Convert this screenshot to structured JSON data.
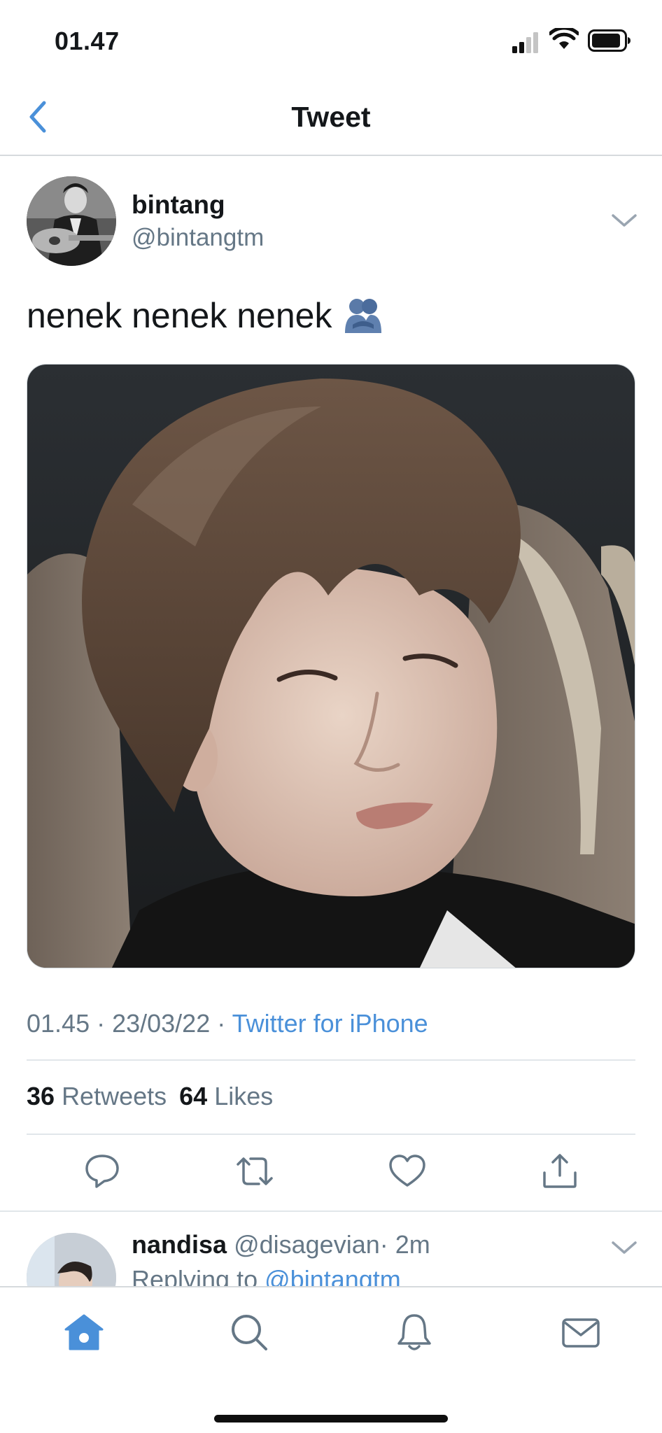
{
  "status_bar": {
    "time": "01.47",
    "icons": [
      "signal-icon",
      "wifi-icon",
      "battery-icon"
    ]
  },
  "nav": {
    "back_icon": "chevron-left-icon",
    "title": "Tweet"
  },
  "tweet": {
    "author": {
      "name": "bintang",
      "handle": "@bintangtm"
    },
    "text": "nenek nenek nenek",
    "emoji": "people-hugging-emoji",
    "media_alt": "photo",
    "meta": {
      "time": "01.45",
      "separator": " · ",
      "date": "23/03/22",
      "source": "Twitter for iPhone"
    },
    "stats": {
      "retweets_count": "36",
      "retweets_label": "Retweets",
      "likes_count": "64",
      "likes_label": "Likes"
    },
    "actions": [
      "reply-icon",
      "retweet-icon",
      "like-icon",
      "share-icon"
    ]
  },
  "reply": {
    "name": "nandisa",
    "handle": "@disagevian",
    "time": "· 2m",
    "replying_prefix": "Replying to",
    "replying_handle": "@bintangtm"
  },
  "tabbar": {
    "tabs": [
      "home-icon",
      "search-icon",
      "notifications-icon",
      "messages-icon"
    ],
    "active": "home-icon"
  },
  "colors": {
    "accent": "#4a90d9",
    "secondary_text": "#657786",
    "primary_text": "#14171a",
    "divider": "#e1e6ea"
  }
}
